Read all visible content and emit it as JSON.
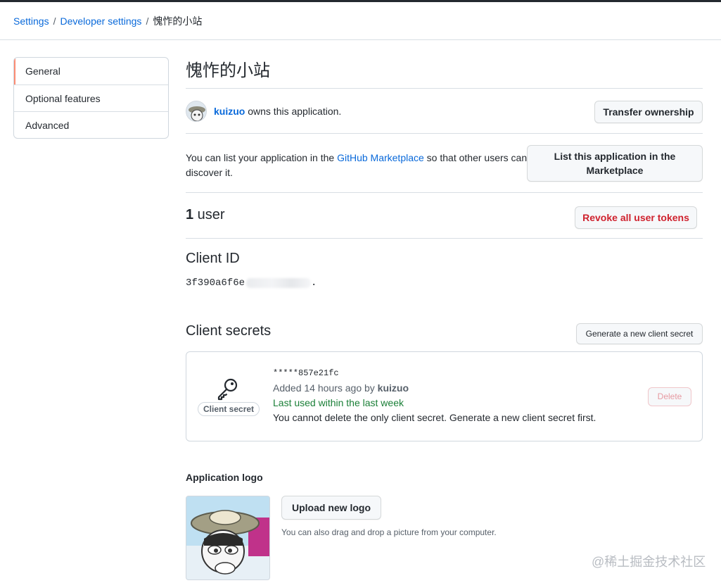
{
  "breadcrumb": {
    "settings": "Settings",
    "developer_settings": "Developer settings",
    "current": "愧怍的小站",
    "separator": "/"
  },
  "sidebar": {
    "items": [
      {
        "label": "General",
        "active": true
      },
      {
        "label": "Optional features"
      },
      {
        "label": "Advanced"
      }
    ]
  },
  "app": {
    "title": "愧怍的小站",
    "owner_name": "kuizuo",
    "owner_suffix": " owns this application.",
    "transfer_button": "Transfer ownership"
  },
  "marketplace": {
    "text_before": "You can list your application in the ",
    "link": "GitHub Marketplace",
    "text_after": " so that other users can discover it.",
    "button": "List this application in the Marketplace"
  },
  "users": {
    "count": "1",
    "label": " user",
    "revoke_button": "Revoke all user tokens"
  },
  "client_id": {
    "title": "Client ID",
    "value_visible": "3f390a6f6e",
    "value_tail": "."
  },
  "client_secrets": {
    "title": "Client secrets",
    "generate_button": "Generate a new client secret",
    "badge": "Client secret",
    "hash": "*****857e21fc",
    "added_prefix": "Added 14 hours ago by ",
    "added_by": "kuizuo",
    "last_used": "Last used within the last week",
    "note": "You cannot delete the only client secret. Generate a new client secret first.",
    "delete_button": "Delete"
  },
  "logo": {
    "title": "Application logo",
    "upload_button": "Upload new logo",
    "note": "You can also drag and drop a picture from your computer."
  },
  "watermark": "@稀土掘金技术社区",
  "colors": {
    "link": "#0969da",
    "danger": "#cf222e",
    "success": "#1a7f37",
    "active_marker": "#fd8c73"
  }
}
